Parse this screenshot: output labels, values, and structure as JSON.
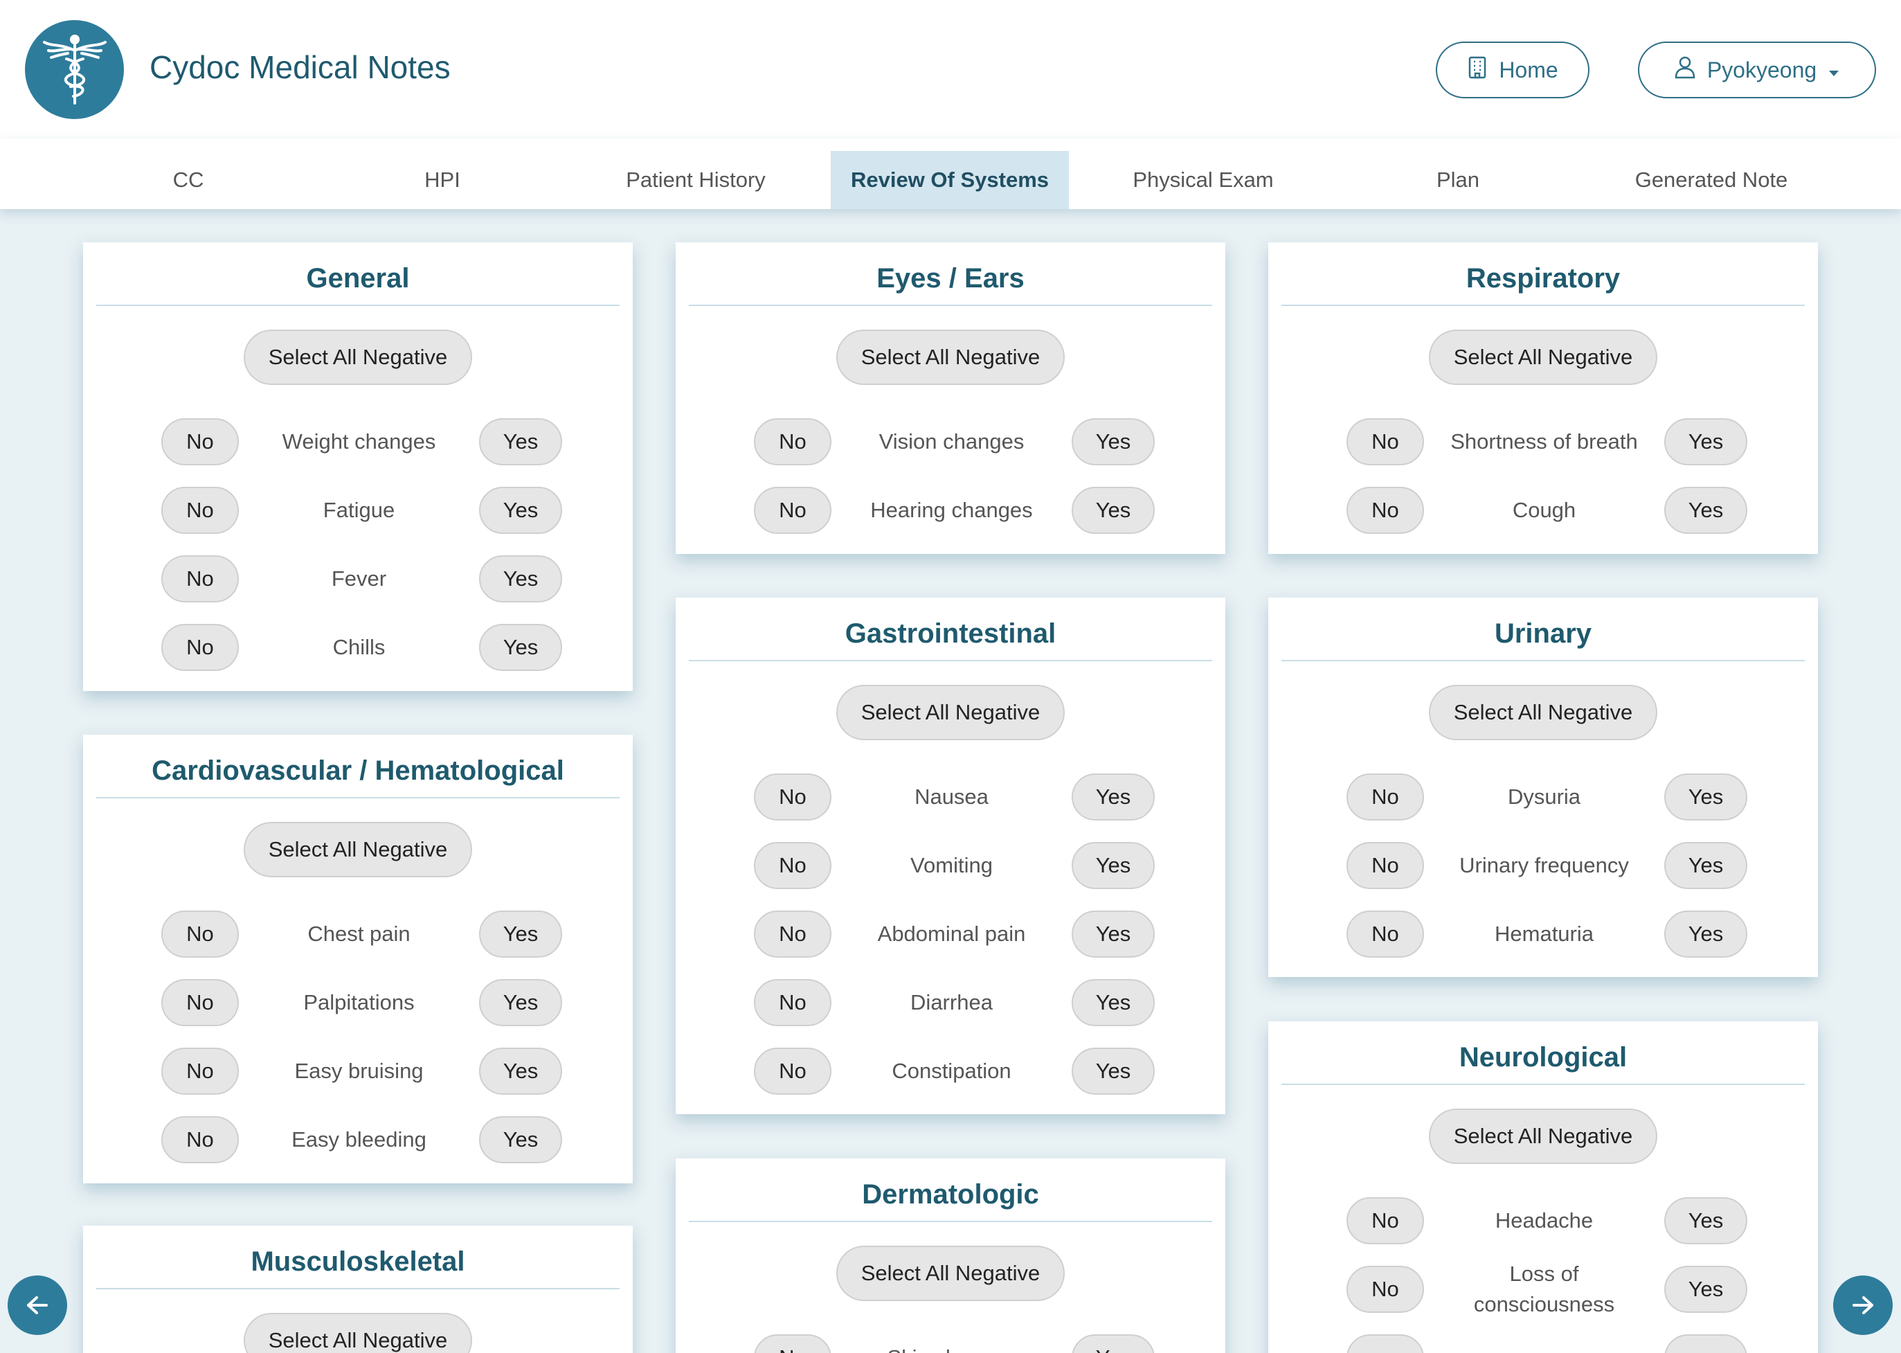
{
  "app": {
    "title": "Cydoc Medical Notes",
    "home_label": "Home",
    "user_label": "Pyokyeong"
  },
  "tabs": [
    "CC",
    "HPI",
    "Patient History",
    "Review Of Systems",
    "Physical Exam",
    "Plan",
    "Generated Note"
  ],
  "active_tab": "Review Of Systems",
  "select_all_label": "Select All Negative",
  "no_label": "No",
  "yes_label": "Yes",
  "cards": [
    {
      "title": "General",
      "symptoms": [
        "Weight changes",
        "Fatigue",
        "Fever",
        "Chills"
      ]
    },
    {
      "title": "Cardiovascular / Hematological",
      "symptoms": [
        "Chest pain",
        "Palpitations",
        "Easy bruising",
        "Easy bleeding"
      ]
    },
    {
      "title": "Musculoskeletal",
      "symptoms": []
    },
    {
      "title": "Eyes / Ears",
      "symptoms": [
        "Vision changes",
        "Hearing changes"
      ]
    },
    {
      "title": "Gastrointestinal",
      "symptoms": [
        "Nausea",
        "Vomiting",
        "Abdominal pain",
        "Diarrhea",
        "Constipation"
      ]
    },
    {
      "title": "Dermatologic",
      "symptoms": [
        "Skin changes"
      ]
    },
    {
      "title": "Respiratory",
      "symptoms": [
        "Shortness of breath",
        "Cough"
      ]
    },
    {
      "title": "Urinary",
      "symptoms": [
        "Dysuria",
        "Urinary frequency",
        "Hematuria"
      ]
    },
    {
      "title": "Neurological",
      "symptoms": [
        "Headache",
        "Loss of consciousness"
      ]
    }
  ],
  "colors": {
    "accent": "#2e7c9b",
    "title_text": "#1f5a6e",
    "background": "#e8f1f4",
    "active_tab_bg": "#d3e5ee"
  },
  "icons": {
    "logo": "caduceus-icon",
    "home": "building-icon",
    "user": "user-icon",
    "dropdown": "caret-down-icon",
    "prev": "arrow-left-icon",
    "next": "arrow-right-icon"
  }
}
